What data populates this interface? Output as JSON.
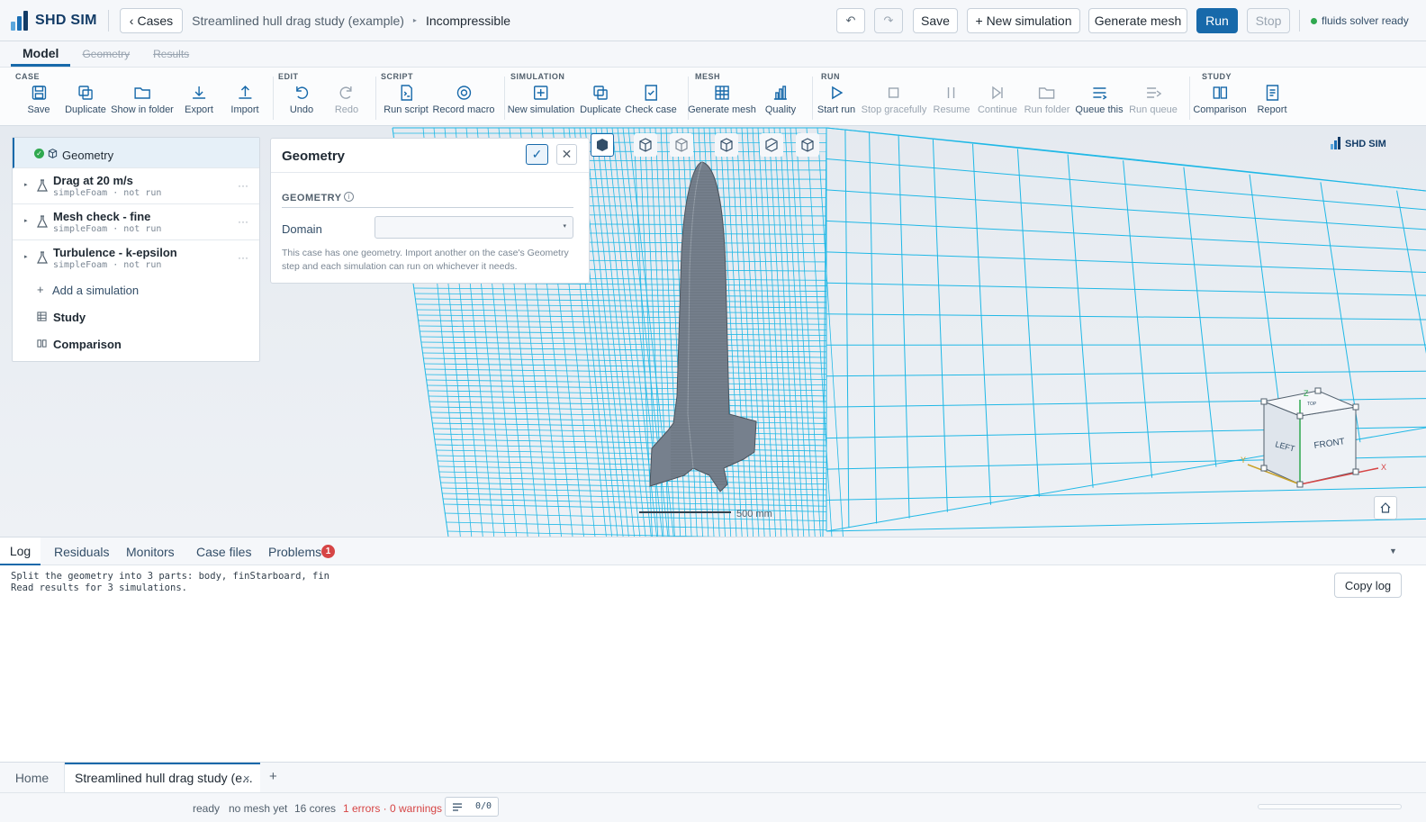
{
  "app": {
    "brand": "SHD SIM"
  },
  "topbar": {
    "back_label": "Cases",
    "crumb_case": "Streamlined hull drag study (example)",
    "crumb_current": "Incompressible",
    "save_label": "Save",
    "new_sim_label": "+ New simulation",
    "generate_mesh_label": "Generate mesh",
    "run_label": "Run",
    "stop_label": "Stop",
    "solver_status": "fluids solver ready",
    "status_color": "#2fa84f"
  },
  "ribbon_tabs": [
    {
      "label": "Model"
    },
    {
      "label": "Geometry"
    },
    {
      "label": "Results"
    }
  ],
  "ribbon": {
    "groups": {
      "case": "CASE",
      "edit": "EDIT",
      "script": "SCRIPT",
      "simulation": "SIMULATION",
      "mesh": "MESH",
      "run": "RUN",
      "study": "STUDY"
    },
    "buttons": {
      "save": "Save",
      "duplicate": "Duplicate",
      "show_in_folder": "Show in folder",
      "export": "Export",
      "import": "Import",
      "undo": "Undo",
      "redo": "Redo",
      "run_script": "Run script",
      "record_macro": "Record macro",
      "new_simulation": "New simulation",
      "sim_duplicate": "Duplicate",
      "check_case": "Check case",
      "generate_mesh": "Generate mesh",
      "quality": "Quality",
      "start_run": "Start run",
      "stop_gracefully": "Stop gracefully",
      "resume": "Resume",
      "continue": "Continue",
      "run_folder": "Run folder",
      "queue_this": "Queue this",
      "run_queue": "Run queue",
      "comparison": "Comparison",
      "report": "Report"
    }
  },
  "tree": {
    "root_label": "Geometry",
    "simulations": [
      {
        "name": "Drag at 20 m/s",
        "sub": "simpleFoam · not run"
      },
      {
        "name": "Mesh check - fine",
        "sub": "simpleFoam · not run"
      },
      {
        "name": "Turbulence - k-epsilon",
        "sub": "simpleFoam · not run"
      }
    ],
    "add_label": "Add a simulation",
    "study_label": "Study",
    "comparison_label": "Comparison",
    "more_glyph": "···"
  },
  "geometry_panel": {
    "title": "Geometry",
    "section": "GEOMETRY",
    "domain_label": "Domain",
    "domain_value": "",
    "help_text": "This case has one geometry. Import another on the case's Geometry step and each simulation can run on whichever it needs."
  },
  "viewport": {
    "watermark": "SHD SIM",
    "scale_label": "500 mm",
    "cube": {
      "left": "LEFT",
      "front": "FRONT",
      "top": "TOP",
      "x": "X",
      "y": "Y",
      "z": "Z"
    },
    "mesh_color": "#1fb8e6"
  },
  "log": {
    "tabs": [
      {
        "label": "Log"
      },
      {
        "label": "Residuals"
      },
      {
        "label": "Monitors"
      },
      {
        "label": "Case files"
      },
      {
        "label": "Problems"
      }
    ],
    "problems_count": "1",
    "lines": [
      "Split the geometry into 3 parts: body, finStarboard, fin",
      "Read results for 3 simulations."
    ],
    "copy_label": "Copy log"
  },
  "doc_tabs": {
    "home": "Home",
    "current": "Streamlined hull drag study (e...",
    "close": "×",
    "add": "+"
  },
  "status": {
    "state": "ready",
    "mesh": "no mesh yet",
    "cores": "16 cores",
    "issues": "1 errors · 0 warnings",
    "queue": "0/0"
  }
}
